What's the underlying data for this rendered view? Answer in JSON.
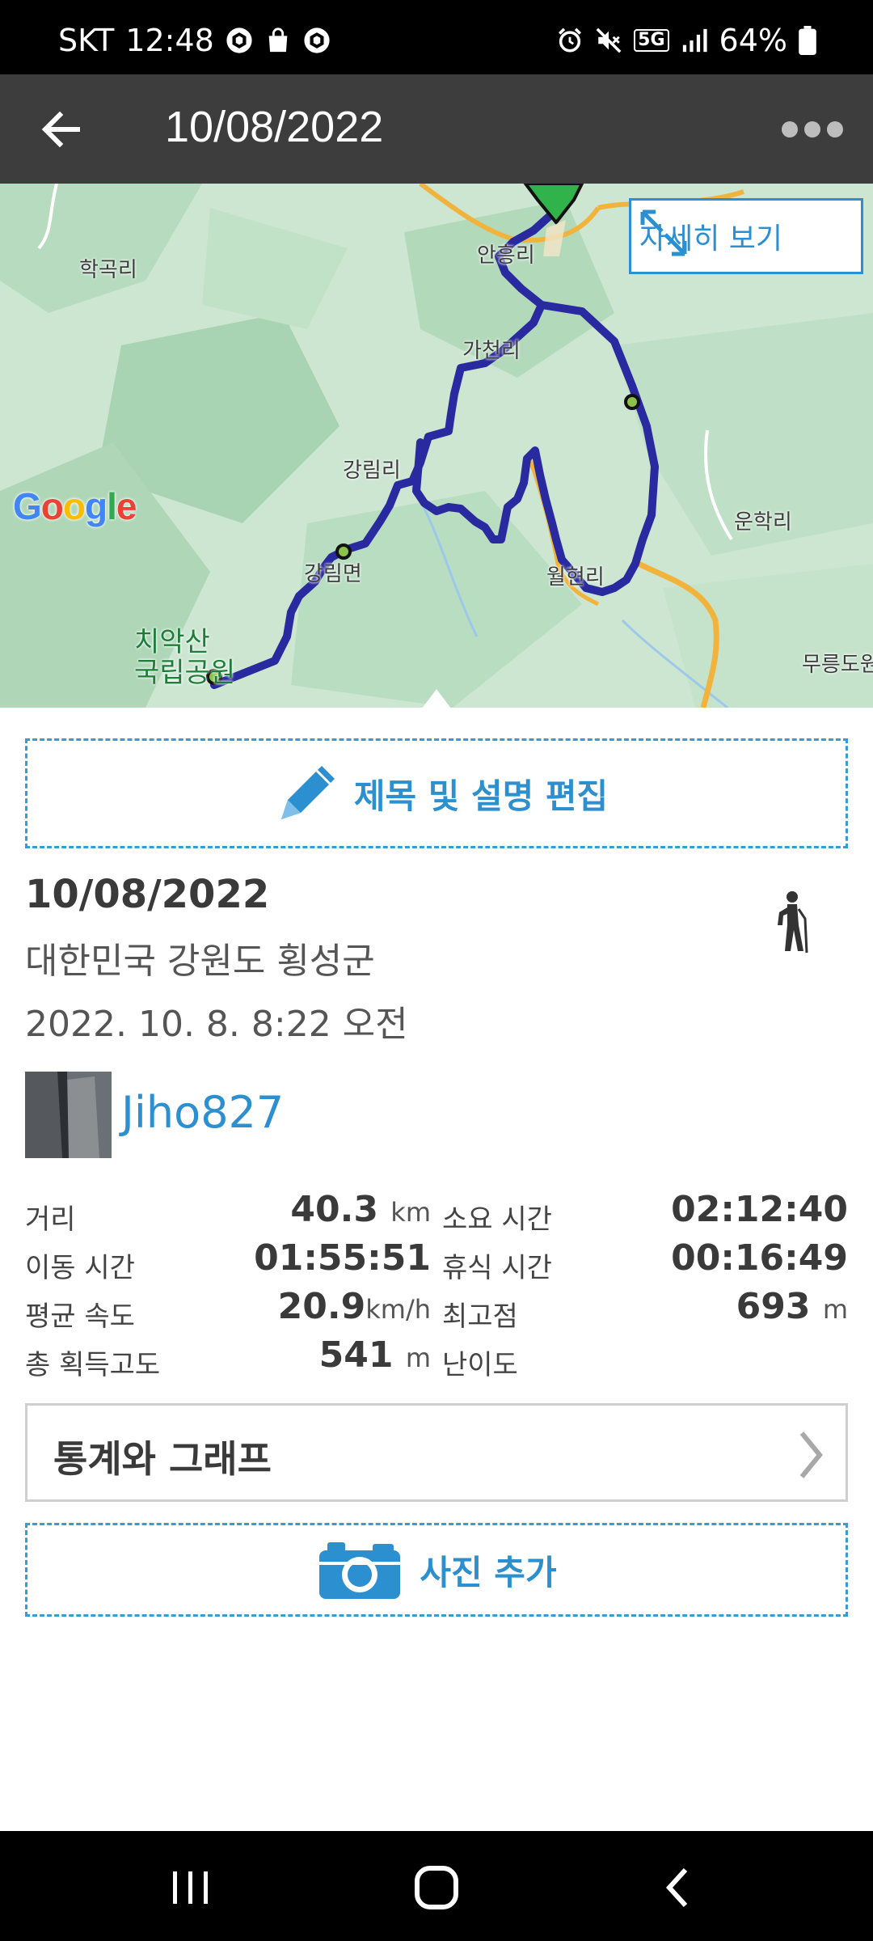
{
  "status_bar": {
    "carrier": "SKT",
    "time": "12:48",
    "network": "5G",
    "battery": "64%",
    "icons": [
      "cube-icon",
      "shopping-bag-icon",
      "cube-icon",
      "alarm-icon",
      "mute-icon",
      "signal-icon",
      "battery-icon"
    ]
  },
  "app_bar": {
    "title": "10/08/2022",
    "back_icon": "arrow-left-icon",
    "more_icon": "more-horizontal-icon"
  },
  "map": {
    "detail_button": "자세히 보기",
    "labels": [
      "학곡리",
      "안흥리",
      "가천리",
      "강림리",
      "운학리",
      "강림면",
      "월현리",
      "무릉도원"
    ],
    "park_label_line1": "치악산",
    "park_label_line2": "국립공원",
    "attribution": "Google",
    "route_color": "#2a2aa0"
  },
  "edit_button": "제목 및 설명 편집",
  "record": {
    "date": "10/08/2022",
    "location": "대한민국 강원도 횡성군",
    "datetime": "2022. 10. 8. 8:22 오전",
    "activity_icon": "hiking-icon",
    "username": "Jiho827"
  },
  "stats": {
    "distance_label": "거리",
    "distance_value": "40.3",
    "distance_unit": "km",
    "total_time_label": "소요 시간",
    "total_time_value": "02:12:40",
    "moving_time_label": "이동 시간",
    "moving_time_value": "01:55:51",
    "rest_time_label": "휴식 시간",
    "rest_time_value": "00:16:49",
    "avg_speed_label": "평균 속도",
    "avg_speed_value": "20.9",
    "avg_speed_unit": "km/h",
    "max_elevation_label": "최고점",
    "max_elevation_value": "693",
    "max_elevation_unit": "m",
    "total_ascent_label": "총 획득고도",
    "total_ascent_value": "541",
    "total_ascent_unit": "m",
    "difficulty_label": "난이도"
  },
  "stats_graph_button": "통계와 그래프",
  "add_photo_button": "사진 추가",
  "colors": {
    "accent": "#2b8fd0",
    "app_bar": "#3d3d3d"
  }
}
